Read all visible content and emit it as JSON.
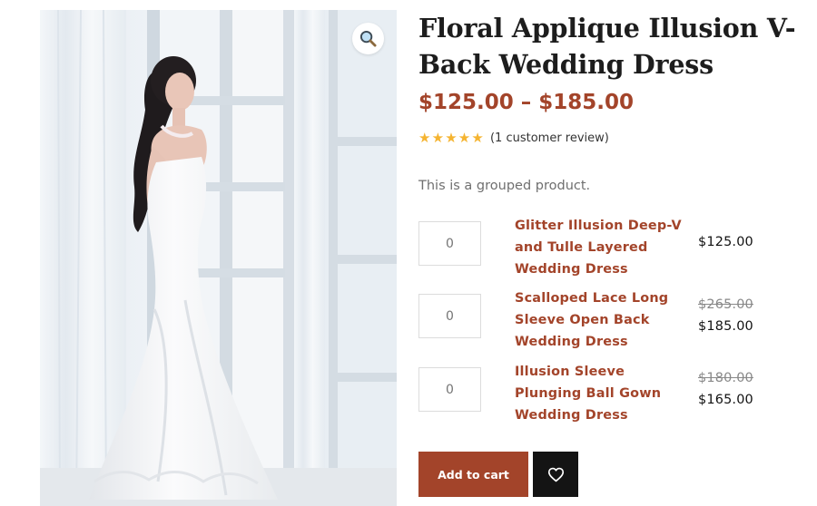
{
  "product": {
    "title": "Floral Applique Illusion V-Back Wedding Dress",
    "price_range": "$125.00 – $185.00",
    "rating": 5,
    "rating_max": 5,
    "review_link": "(1 customer review)",
    "short_description": "This is a grouped product.",
    "image_alt": "Bride in white strapless lace mermaid wedding dress beside a window"
  },
  "grouped_products": [
    {
      "quantity": "",
      "quantity_placeholder": "0",
      "name": "Glitter Illusion Deep-V and Tulle Layered Wedding Dress",
      "price": "$125.00",
      "regular_price": ""
    },
    {
      "quantity": "",
      "quantity_placeholder": "0",
      "name": "Scalloped Lace Long Sleeve Open Back Wedding Dress",
      "price": "$185.00",
      "regular_price": "$265.00"
    },
    {
      "quantity": "",
      "quantity_placeholder": "0",
      "name": "Illusion Sleeve Plunging Ball Gown Wedding Dress",
      "price": "$165.00",
      "regular_price": "$180.00"
    }
  ],
  "actions": {
    "add_to_cart_label": "Add to cart"
  },
  "icons": {
    "zoom": "magnifier-icon",
    "wishlist": "heart-icon",
    "rating": "star-icon"
  },
  "colors": {
    "accent": "#a3442a",
    "star": "#f5b431",
    "wishlist_bg": "#141414"
  }
}
